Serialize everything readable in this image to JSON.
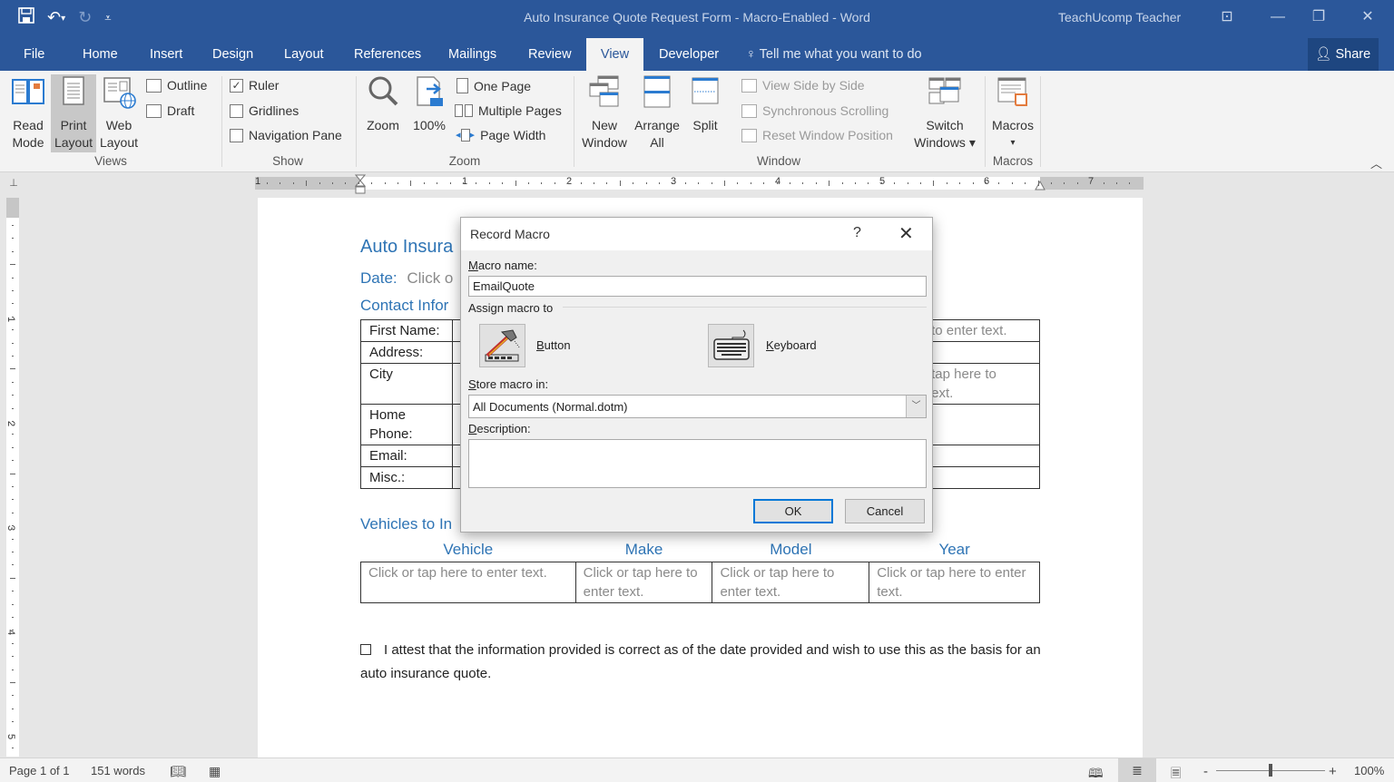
{
  "window": {
    "title": "Auto Insurance Quote Request Form - Macro-Enabled - Word",
    "user": "TeachUcomp Teacher",
    "qat": {
      "save_icon": "save-icon",
      "undo_icon": "undo-icon",
      "redo_icon": "redo-icon",
      "customize_icon": "customize-qat-icon"
    },
    "controls": {
      "ribbon_display": "⊡",
      "minimize": "—",
      "restore": "❐",
      "close": "✕"
    }
  },
  "tabs": [
    {
      "label": "File"
    },
    {
      "label": "Home"
    },
    {
      "label": "Insert"
    },
    {
      "label": "Design"
    },
    {
      "label": "Layout"
    },
    {
      "label": "References"
    },
    {
      "label": "Mailings"
    },
    {
      "label": "Review"
    },
    {
      "label": "View",
      "active": true
    },
    {
      "label": "Developer"
    }
  ],
  "tell_me": "Tell me what you want to do",
  "share_label": "Share",
  "ribbon": {
    "views": {
      "label": "Views",
      "read_mode": "Read Mode",
      "read_mode_l1": "Read",
      "read_mode_l2": "Mode",
      "print_layout_l1": "Print",
      "print_layout_l2": "Layout",
      "web_layout_l1": "Web",
      "web_layout_l2": "Layout",
      "outline": "Outline",
      "draft": "Draft"
    },
    "show": {
      "label": "Show",
      "ruler": "Ruler",
      "ruler_checked": true,
      "gridlines": "Gridlines",
      "gridlines_checked": false,
      "navigation_pane": "Navigation Pane",
      "navigation_pane_checked": false
    },
    "zoom": {
      "label": "Zoom",
      "zoom": "Zoom",
      "hundred": "100%",
      "one_page": "One Page",
      "multiple_pages": "Multiple Pages",
      "page_width": "Page Width"
    },
    "window": {
      "label": "Window",
      "new_window_l1": "New",
      "new_window_l2": "Window",
      "arrange_all_l1": "Arrange",
      "arrange_all_l2": "All",
      "split": "Split",
      "view_side_by_side": "View Side by Side",
      "synchronous_scrolling": "Synchronous Scrolling",
      "reset_window_position": "Reset Window Position",
      "switch_windows_l1": "Switch",
      "switch_windows_l2": "Windows ▾"
    },
    "macros": {
      "label": "Macros",
      "macros": "Macros",
      "dropdown": "▾"
    }
  },
  "ruler": {
    "horizontal_numbers": [
      "1",
      "1",
      "2",
      "3",
      "4",
      "5",
      "6",
      "7"
    ],
    "vertical_numbers": [
      "1",
      "2",
      "3",
      "4",
      "5"
    ]
  },
  "document": {
    "title": "Auto Insura",
    "date_label": "Date:",
    "date_placeholder": "Click o",
    "contact_heading": "Contact Infor",
    "contact_rows": [
      {
        "label": "First Name:",
        "right": "to enter text."
      },
      {
        "label": "Address:",
        "right": ""
      },
      {
        "label": "City",
        "right": "tap here to",
        "right2": "ext."
      },
      {
        "label": "Home",
        "label2": "Phone:",
        "right": ""
      },
      {
        "label": "Email:",
        "right": ""
      },
      {
        "label": "Misc.:",
        "right": ""
      }
    ],
    "vehicles_heading": "Vehicles to In",
    "vehicle_columns": [
      "Vehicle",
      "Make",
      "Model",
      "Year"
    ],
    "vehicle_cells": [
      "Click or tap here to enter text.",
      "Click or tap here to enter text.",
      "Click or tap here to enter text.",
      "Click or tap here to enter text."
    ],
    "attest_text": "I attest that the information provided is correct as of the date provided and wish to use this as the basis for an auto insurance quote.",
    "attest_checked": false
  },
  "dialog": {
    "title": "Record Macro",
    "help": "?",
    "close": "✕",
    "macro_name_label_u": "M",
    "macro_name_label_rest": "acro name:",
    "macro_name_value": "EmailQuote",
    "assign_label": "Assign macro to",
    "button_label_u": "B",
    "button_label_rest": "utton",
    "keyboard_label_u": "K",
    "keyboard_label_rest": "eyboard",
    "store_label_u": "S",
    "store_label_rest": "tore macro in:",
    "store_value": "All Documents (Normal.dotm)",
    "description_label_u": "D",
    "description_label_rest": "escription:",
    "description_value": "",
    "ok": "OK",
    "cancel": "Cancel"
  },
  "status": {
    "page": "Page 1 of 1",
    "words": "151 words",
    "zoom_percent": "100%",
    "zoom_minus": "-",
    "zoom_plus": "+",
    "zoom_level": 100
  },
  "colors": {
    "brand": "#2b579a",
    "heading": "#2e74b5",
    "default_button": "#0078d7"
  }
}
